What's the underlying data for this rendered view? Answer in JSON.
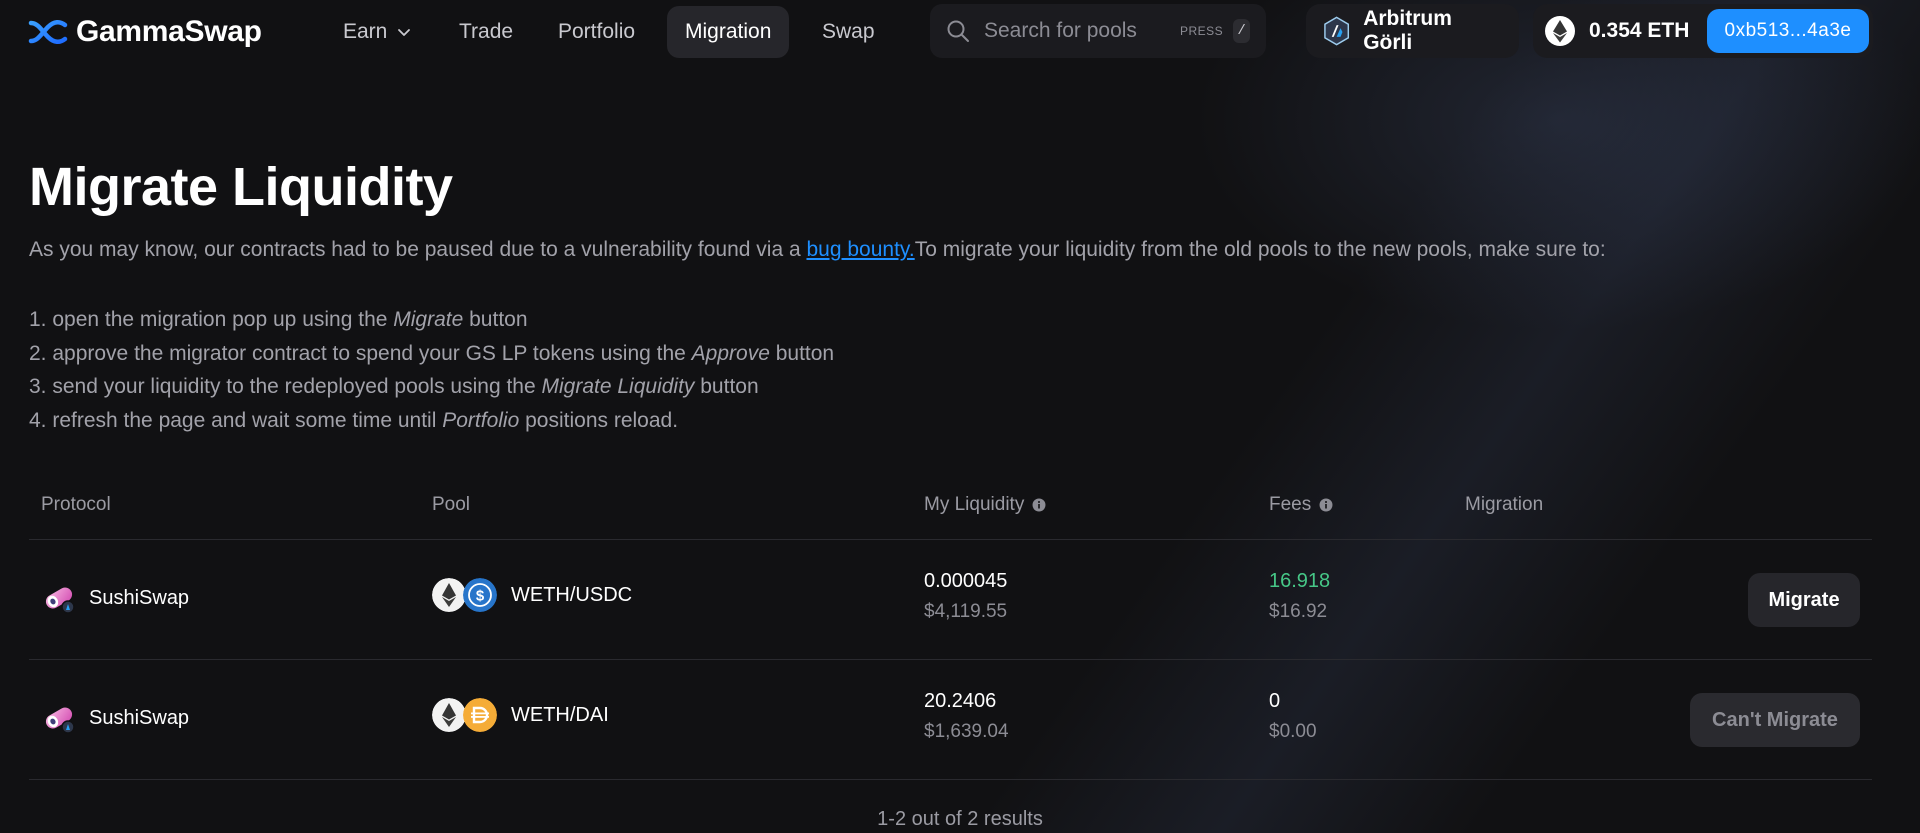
{
  "brand": {
    "name": "GammaSwap"
  },
  "nav": {
    "items": [
      {
        "label": "Earn"
      },
      {
        "label": "Trade"
      },
      {
        "label": "Portfolio"
      },
      {
        "label": "Migration"
      },
      {
        "label": "Swap"
      }
    ],
    "active": "Migration"
  },
  "search": {
    "placeholder": "Search for pools",
    "press_label": "PRESS",
    "shortcut": "/"
  },
  "network": {
    "name": "Arbitrum Görli"
  },
  "wallet": {
    "balance": "0.354 ETH",
    "address": "0xb513...4a3e"
  },
  "page": {
    "title": "Migrate Liquidity",
    "intro_before": "As you may know, our contracts had to be paused due to a vulnerability found via a ",
    "intro_link": "bug bounty.",
    "intro_after": "To migrate your liquidity from the old pools to the new pools, make sure to:",
    "steps": [
      {
        "before": "1. open the migration pop up using the ",
        "em": "Migrate",
        "after": " button"
      },
      {
        "before": "2. approve the migrator contract to spend your GS LP tokens using the ",
        "em": "Approve",
        "after": " button"
      },
      {
        "before": "3. send your liquidity to the redeployed pools using the ",
        "em": "Migrate Liquidity",
        "after": " button"
      },
      {
        "before": "4. refresh the page and wait some time until ",
        "em": "Portfolio",
        "after": " positions reload."
      }
    ]
  },
  "table": {
    "headers": {
      "protocol": "Protocol",
      "pool": "Pool",
      "liquidity": "My Liquidity",
      "fees": "Fees",
      "migration": "Migration"
    },
    "rows": [
      {
        "protocol": "SushiSwap",
        "pool": "WETH/USDC",
        "liquidity": "0.000045",
        "liquidity_usd": "$4,119.55",
        "fees": "16.918",
        "fees_usd": "$16.92",
        "action": "Migrate"
      },
      {
        "protocol": "SushiSwap",
        "pool": "WETH/DAI",
        "liquidity": "20.2406",
        "liquidity_usd": "$1,639.04",
        "fees": "0",
        "fees_usd": "$0.00",
        "action": "Can't Migrate"
      }
    ],
    "results": "1-2 out of 2 results"
  },
  "colors": {
    "background": "#111113",
    "accent": "#1e8fff",
    "positive": "#46c787",
    "muted_text": "#a2a2aa"
  }
}
